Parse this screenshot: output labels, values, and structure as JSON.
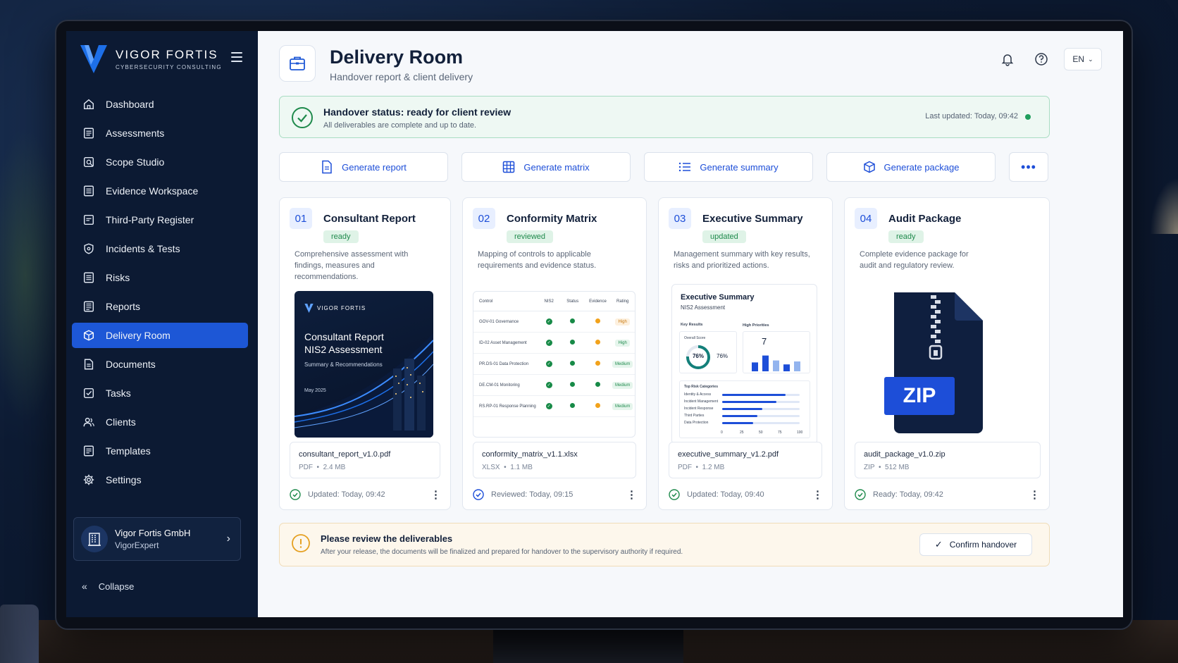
{
  "brand": {
    "name": "VIGOR FORTIS",
    "tagline": "CYBERSECURITY CONSULTING"
  },
  "sidebar": {
    "items": [
      {
        "label": "Dashboard",
        "icon": "home-icon"
      },
      {
        "label": "Assessments",
        "icon": "list-icon"
      },
      {
        "label": "Scope Studio",
        "icon": "scope-icon"
      },
      {
        "label": "Evidence Workspace",
        "icon": "document-icon"
      },
      {
        "label": "Third-Party Register",
        "icon": "register-icon"
      },
      {
        "label": "Incidents & Tests",
        "icon": "shield-icon"
      },
      {
        "label": "Risks",
        "icon": "document-icon"
      },
      {
        "label": "Reports",
        "icon": "report-icon"
      },
      {
        "label": "Delivery Room",
        "icon": "cube-icon",
        "active": true
      },
      {
        "label": "Documents",
        "icon": "file-icon"
      },
      {
        "label": "Tasks",
        "icon": "checkbox-icon"
      },
      {
        "label": "Clients",
        "icon": "users-icon"
      },
      {
        "label": "Templates",
        "icon": "template-icon"
      },
      {
        "label": "Settings",
        "icon": "gear-icon"
      }
    ],
    "org": {
      "name": "Vigor Fortis GmbH",
      "sub": "VigorExpert"
    },
    "collapse_label": "Collapse"
  },
  "header": {
    "title": "Delivery Room",
    "subtitle": "Handover report & client delivery",
    "language": "EN"
  },
  "status": {
    "title": "Handover status: ready for client review",
    "desc": "All deliverables are complete and up to date.",
    "updated": "Last updated: Today, 09:42"
  },
  "actions": {
    "report": "Generate report",
    "matrix": "Generate matrix",
    "summary": "Generate summary",
    "package": "Generate package"
  },
  "cards": [
    {
      "num": "01",
      "title": "Consultant Report",
      "badge": "ready",
      "desc": "Comprehensive assessment with findings, measures and recommendations.",
      "file": "consultant_report_v1.0.pdf",
      "type": "PDF",
      "size": "2.4 MB",
      "footer": "Updated: Today, 09:42"
    },
    {
      "num": "02",
      "title": "Conformity Matrix",
      "badge": "reviewed",
      "desc": "Mapping of controls to applicable requirements and evidence status.",
      "file": "conformity_matrix_v1.1.xlsx",
      "type": "XLSX",
      "size": "1.1 MB",
      "footer": "Reviewed: Today, 09:15"
    },
    {
      "num": "03",
      "title": "Executive Summary",
      "badge": "updated",
      "desc": "Management summary with key results, risks and prioritized actions.",
      "file": "executive_summary_v1.2.pdf",
      "type": "PDF",
      "size": "1.2 MB",
      "footer": "Updated: Today, 09:40"
    },
    {
      "num": "04",
      "title": "Audit Package",
      "badge": "ready",
      "desc": "Complete evidence package for audit and regulatory review.",
      "file": "audit_package_v1.0.zip",
      "type": "ZIP",
      "size": "512 MB",
      "footer": "Ready: Today, 09:42"
    }
  ],
  "report_cover": {
    "brand": "VIGOR FORTIS",
    "title_line1": "Consultant Report",
    "title_line2": "NIS2 Assessment",
    "sub": "Summary & Recommendations",
    "date": "May 2025"
  },
  "matrix": {
    "headers": [
      "Control",
      "NIS2",
      "Status",
      "Evidence",
      "Rating"
    ],
    "rows": [
      {
        "control": "GOV-01 Governance",
        "evidence": "orange",
        "rating": "High"
      },
      {
        "control": "ID-02 Asset Management",
        "evidence": "orange",
        "rating": "High"
      },
      {
        "control": "PR.DS-01 Data Protection",
        "evidence": "orange",
        "rating": "Medium"
      },
      {
        "control": "DE.CM-01 Monitoring",
        "evidence": "green",
        "rating": "Medium"
      },
      {
        "control": "RS.RP-01 Response Planning",
        "evidence": "orange",
        "rating": "Medium"
      }
    ]
  },
  "exec_summary": {
    "title": "Executive Summary",
    "sub": "NIS2 Assessment",
    "key_results": "Key Results",
    "high_priorities": "High Priorities",
    "overall_score": "Overall Score",
    "score": "76%",
    "score_value": 76,
    "priorities_count": "7",
    "priority_bars": [
      0.45,
      0.8,
      0.55,
      0.35,
      0.5
    ],
    "risk_title": "Top Risk Categories",
    "risk_categories": [
      {
        "label": "Identity & Access",
        "value": 82
      },
      {
        "label": "Incident Management",
        "value": 70
      },
      {
        "label": "Incident Response",
        "value": 52
      },
      {
        "label": "Third Parties",
        "value": 45
      },
      {
        "label": "Data Protection",
        "value": 40
      }
    ],
    "axis_ticks": [
      "0",
      "25",
      "50",
      "75",
      "100"
    ]
  },
  "zip_label": "ZIP",
  "review": {
    "title": "Please review the deliverables",
    "desc": "After your release, the documents will be finalized and prepared for handover to the supervisory authority if required.",
    "confirm": "Confirm handover"
  },
  "colors": {
    "accent": "#1d57d6",
    "success": "#1f9e5c",
    "sidebar": "#0c1a33"
  }
}
